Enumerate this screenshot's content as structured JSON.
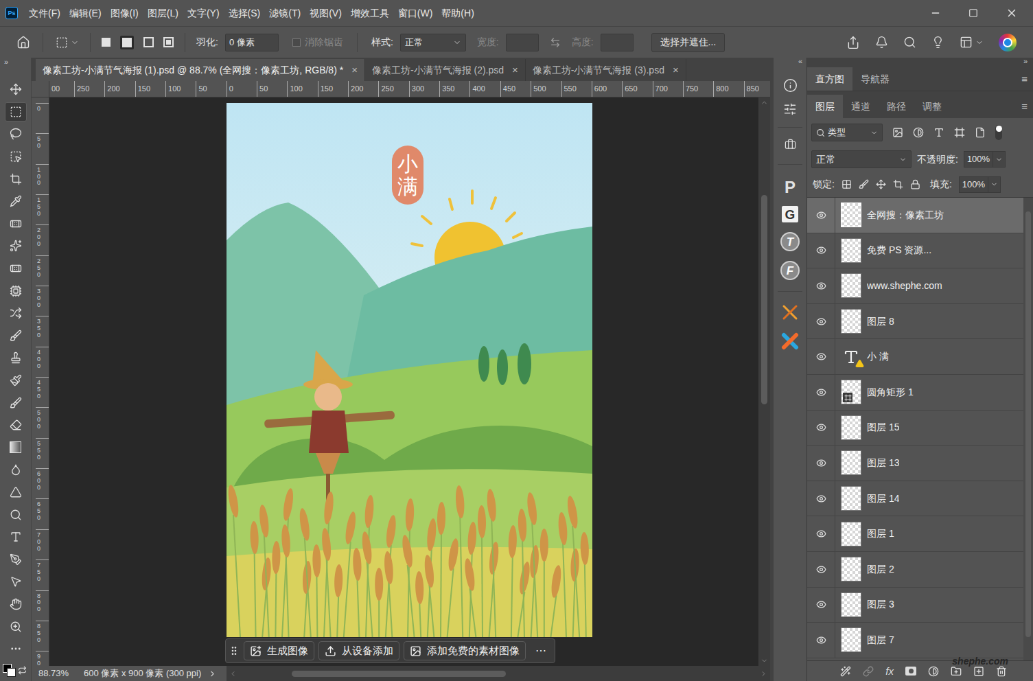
{
  "app": {
    "logo": "Ps"
  },
  "menu": [
    "文件(F)",
    "编辑(E)",
    "图像(I)",
    "图层(L)",
    "文字(Y)",
    "选择(S)",
    "滤镜(T)",
    "视图(V)",
    "增效工具",
    "窗口(W)",
    "帮助(H)"
  ],
  "options_bar": {
    "feather_label": "羽化:",
    "feather_value": "0 像素",
    "antialias_label": "消除锯齿",
    "antialias_checked": false,
    "antialias_disabled": true,
    "style_label": "样式:",
    "style_value": "正常",
    "width_label": "宽度:",
    "width_value": "",
    "height_label": "高度:",
    "height_value": "",
    "select_mask_button": "选择并遮住..."
  },
  "toolbar": {
    "collapse": "»",
    "tools": [
      {
        "kind": "move",
        "selected": false
      },
      {
        "kind": "marquee",
        "selected": true
      },
      {
        "kind": "lasso",
        "selected": false
      },
      {
        "kind": "object-select",
        "selected": false
      },
      {
        "kind": "crop",
        "selected": false
      },
      {
        "kind": "eyedropper",
        "selected": false
      },
      {
        "kind": "spot-healing",
        "selected": false
      },
      {
        "kind": "remove",
        "selected": false
      },
      {
        "kind": "healing",
        "selected": false
      },
      {
        "kind": "frame",
        "selected": false
      },
      {
        "kind": "content-move",
        "selected": false
      },
      {
        "kind": "brush",
        "selected": false
      },
      {
        "kind": "stamp",
        "selected": false
      },
      {
        "kind": "history-brush",
        "selected": false
      },
      {
        "kind": "mixer-brush",
        "selected": false
      },
      {
        "kind": "eraser",
        "selected": false
      },
      {
        "kind": "gradient",
        "selected": false
      },
      {
        "kind": "blur",
        "selected": false
      },
      {
        "kind": "sharpen",
        "selected": false
      },
      {
        "kind": "dodge",
        "selected": false
      },
      {
        "kind": "type",
        "selected": false
      },
      {
        "kind": "pen",
        "selected": false
      },
      {
        "kind": "path-select",
        "selected": false
      },
      {
        "kind": "hand",
        "selected": false
      },
      {
        "kind": "zoom",
        "selected": false
      },
      {
        "kind": "more",
        "selected": false
      }
    ]
  },
  "document_tabs": [
    {
      "label": "像素工坊-小满节气海报 (1).psd @ 88.7% (全网搜：像素工坊, RGB/8) *",
      "selected": true,
      "close": "×"
    },
    {
      "label": "像素工坊-小满节气海报 (2).psd",
      "selected": false,
      "close": "×"
    },
    {
      "label": "像素工坊-小满节气海报 (3).psd",
      "selected": false,
      "close": "×"
    }
  ],
  "rulers": {
    "horizontal": [
      "00",
      "250",
      "200",
      "150",
      "100",
      "50",
      "0",
      "50",
      "100",
      "150",
      "200",
      "250",
      "300",
      "350",
      "400",
      "450",
      "500",
      "550",
      "600",
      "650",
      "700",
      "750",
      "800",
      "850"
    ],
    "vertical": [
      "0",
      "50",
      "100",
      "150",
      "200",
      "250",
      "300",
      "350",
      "400",
      "450",
      "500",
      "550",
      "600",
      "650",
      "700",
      "750",
      "800",
      "850",
      "90"
    ]
  },
  "canvas": {
    "tag_text": "小满",
    "taskbar": [
      {
        "kind": "generate",
        "label": "生成图像"
      },
      {
        "kind": "device",
        "label": "从设备添加"
      },
      {
        "kind": "stock",
        "label": "添加免费的素材图像"
      }
    ],
    "more": "⋯"
  },
  "status_bar": {
    "zoom": "88.73%",
    "size": "600 像素 x 900 像素 (300 ppi)"
  },
  "dock": {
    "collapse": "«",
    "plugins": [
      {
        "glyph": "P",
        "kind": "plain"
      },
      {
        "glyph": "G",
        "kind": "boxed"
      },
      {
        "glyph": "T",
        "kind": "badge"
      },
      {
        "glyph": "F",
        "kind": "badge"
      }
    ]
  },
  "panels": {
    "collapse": "»",
    "top_tabs": [
      {
        "label": "直方图",
        "selected": true
      },
      {
        "label": "导航器",
        "selected": false
      }
    ],
    "menu_glyph": "≡",
    "layers_tabs": [
      {
        "label": "图层",
        "selected": true
      },
      {
        "label": "通道",
        "selected": false
      },
      {
        "label": "路径",
        "selected": false
      },
      {
        "label": "调整",
        "selected": false
      }
    ],
    "filter_label": "类型",
    "blend_mode": "正常",
    "opacity_label": "不透明度:",
    "opacity": "100%",
    "lock_label": "锁定:",
    "fill_label": "填充:",
    "fill": "100%",
    "layers": [
      {
        "name": "全网搜：像素工坊",
        "kind": "pixel",
        "visible": true,
        "selected": true,
        "warning": false
      },
      {
        "name": "免费 PS 资源...",
        "kind": "pixel",
        "visible": true,
        "selected": false,
        "warning": false
      },
      {
        "name": "www.shephe.com",
        "kind": "pixel",
        "visible": true,
        "selected": false,
        "warning": false
      },
      {
        "name": "图层 8",
        "kind": "pixel",
        "visible": true,
        "selected": false,
        "warning": false
      },
      {
        "name": "小 满",
        "kind": "text",
        "visible": true,
        "selected": false,
        "warning": true
      },
      {
        "name": "圆角矩形 1",
        "kind": "shape",
        "visible": true,
        "selected": false,
        "warning": false
      },
      {
        "name": "图层 15",
        "kind": "pixel",
        "visible": true,
        "selected": false,
        "warning": false
      },
      {
        "name": "图层 13",
        "kind": "pixel",
        "visible": true,
        "selected": false,
        "warning": false
      },
      {
        "name": "图层 14",
        "kind": "pixel",
        "visible": true,
        "selected": false,
        "warning": false
      },
      {
        "name": "图层 1",
        "kind": "pixel",
        "visible": true,
        "selected": false,
        "warning": false
      },
      {
        "name": "图层 2",
        "kind": "pixel",
        "visible": true,
        "selected": false,
        "warning": false
      },
      {
        "name": "图层 3",
        "kind": "pixel",
        "visible": true,
        "selected": false,
        "warning": false
      },
      {
        "name": "图层 7",
        "kind": "pixel",
        "visible": true,
        "selected": false,
        "warning": false
      }
    ],
    "footer_fx": "fx"
  },
  "watermark": "shephe.com"
}
